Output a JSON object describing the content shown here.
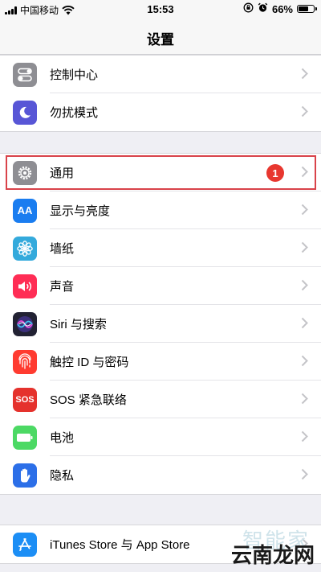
{
  "status_bar": {
    "carrier": "中国移动",
    "time": "15:53",
    "battery_percent": "66%",
    "battery_level": 0.66,
    "icons": [
      "signal-icon",
      "wifi-icon",
      "rotation-lock-icon",
      "alarm-icon",
      "battery-icon"
    ]
  },
  "nav": {
    "title": "设置"
  },
  "group1": {
    "items": [
      {
        "label": "控制中心",
        "icon": "control-center-icon",
        "color": "#8e8e93"
      },
      {
        "label": "勿扰模式",
        "icon": "moon-icon",
        "color": "#5856d6"
      }
    ]
  },
  "group2": {
    "items": [
      {
        "label": "通用",
        "icon": "gear-icon",
        "color": "#8e8e93",
        "badge": "1"
      },
      {
        "label": "显示与亮度",
        "icon": "display-brightness-icon",
        "color": "#1a7df0",
        "icon_text": "AA"
      },
      {
        "label": "墙纸",
        "icon": "wallpaper-icon",
        "color": "#34aadc"
      },
      {
        "label": "声音",
        "icon": "speaker-icon",
        "color": "#ff2d55"
      },
      {
        "label": "Siri 与搜索",
        "icon": "siri-icon",
        "color": "#222233"
      },
      {
        "label": "触控 ID 与密码",
        "icon": "fingerprint-icon",
        "color": "#ff3b30"
      },
      {
        "label": "SOS 紧急联络",
        "icon": "sos-icon",
        "color": "#e5322d",
        "icon_text": "SOS"
      },
      {
        "label": "电池",
        "icon": "battery-setting-icon",
        "color": "#4cd964"
      },
      {
        "label": "隐私",
        "icon": "hand-icon",
        "color": "#2c6fe8"
      }
    ]
  },
  "group3": {
    "items": [
      {
        "label": "iTunes Store 与 App Store",
        "icon": "app-store-icon",
        "color": "#1c8ef5"
      }
    ]
  },
  "watermark": {
    "text": "云南龙网",
    "faint": "智能家"
  }
}
